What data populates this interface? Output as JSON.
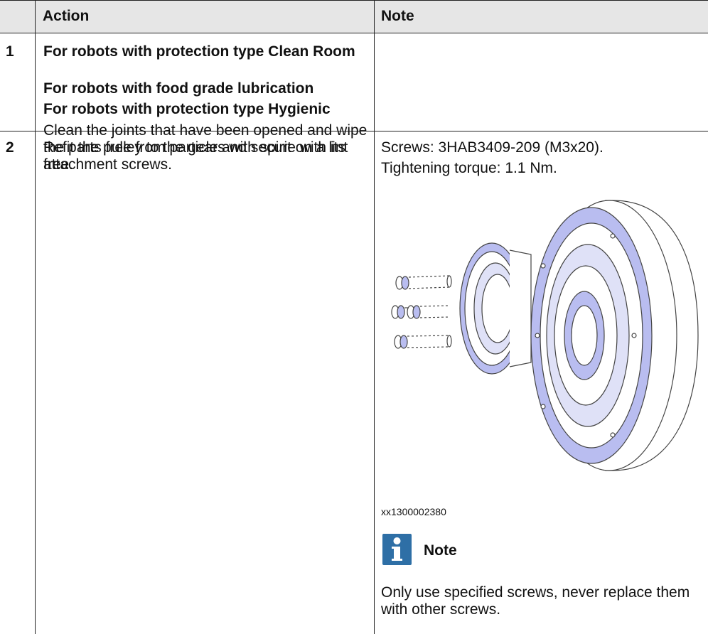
{
  "header": {
    "num": "",
    "action": "Action",
    "note": "Note"
  },
  "rows": [
    {
      "num": "1",
      "action_lines": [
        "For robots with protection type Clean Room",
        "For robots with food grade lubrication",
        "For robots with protection type Hygienic"
      ],
      "action_text": "Clean the joints that have been opened and wipe the parts free from particles with spirit on a lint free."
    },
    {
      "num": "2",
      "action_text": "Refit the pulley to the gear and secure with its attachment screws.",
      "note_screws": "Screws: 3HAB3409-209 (M3x20).",
      "note_torque": "Tightening torque: 1.1 Nm.",
      "figure_id": "xx1300002380",
      "note_title": "Note",
      "note_body": "Only use specified screws, never replace them with other screws."
    }
  ],
  "colors": {
    "header_bg": "#e6e6e6",
    "rule": "#222222",
    "note_icon": "#2e6fa6",
    "part_blue": "#b9bdf0"
  }
}
